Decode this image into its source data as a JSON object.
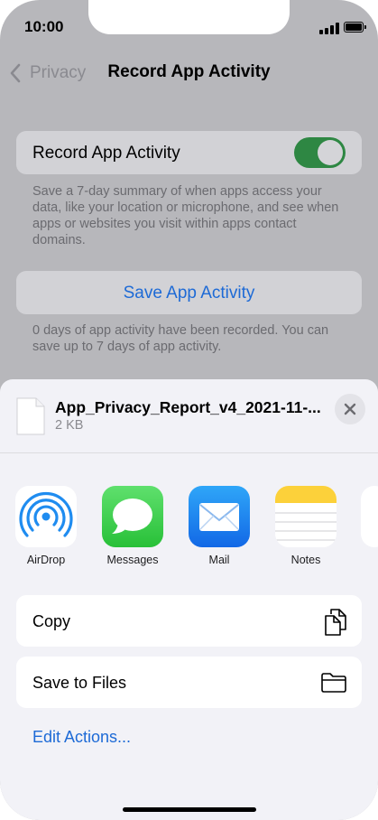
{
  "status_bar": {
    "time": "10:00"
  },
  "nav": {
    "back_label": "Privacy",
    "title": "Record App Activity"
  },
  "settings": {
    "toggle_label": "Record App Activity",
    "toggle_on": true,
    "toggle_description": "Save a 7-day summary of when apps access your data, like your location or microphone, and see when apps or websites you visit within apps contact domains.",
    "save_button_label": "Save App Activity",
    "save_description": "0 days of app activity have been recorded. You can save up to 7 days of app activity."
  },
  "share_sheet": {
    "file_name": "App_Privacy_Report_v4_2021-11-...",
    "file_size": "2 KB",
    "apps": [
      {
        "label": "AirDrop",
        "icon": "airdrop-icon"
      },
      {
        "label": "Messages",
        "icon": "messages-icon"
      },
      {
        "label": "Mail",
        "icon": "mail-icon"
      },
      {
        "label": "Notes",
        "icon": "notes-icon"
      }
    ],
    "actions": [
      {
        "label": "Copy",
        "icon": "copy-icon"
      },
      {
        "label": "Save to Files",
        "icon": "folder-icon"
      }
    ],
    "edit_actions_label": "Edit Actions..."
  },
  "colors": {
    "accent_blue": "#1d6ad6",
    "toggle_green": "#2e8743",
    "dimmed_background": "#b7b7bb",
    "sheet_background": "#f2f2f7"
  }
}
